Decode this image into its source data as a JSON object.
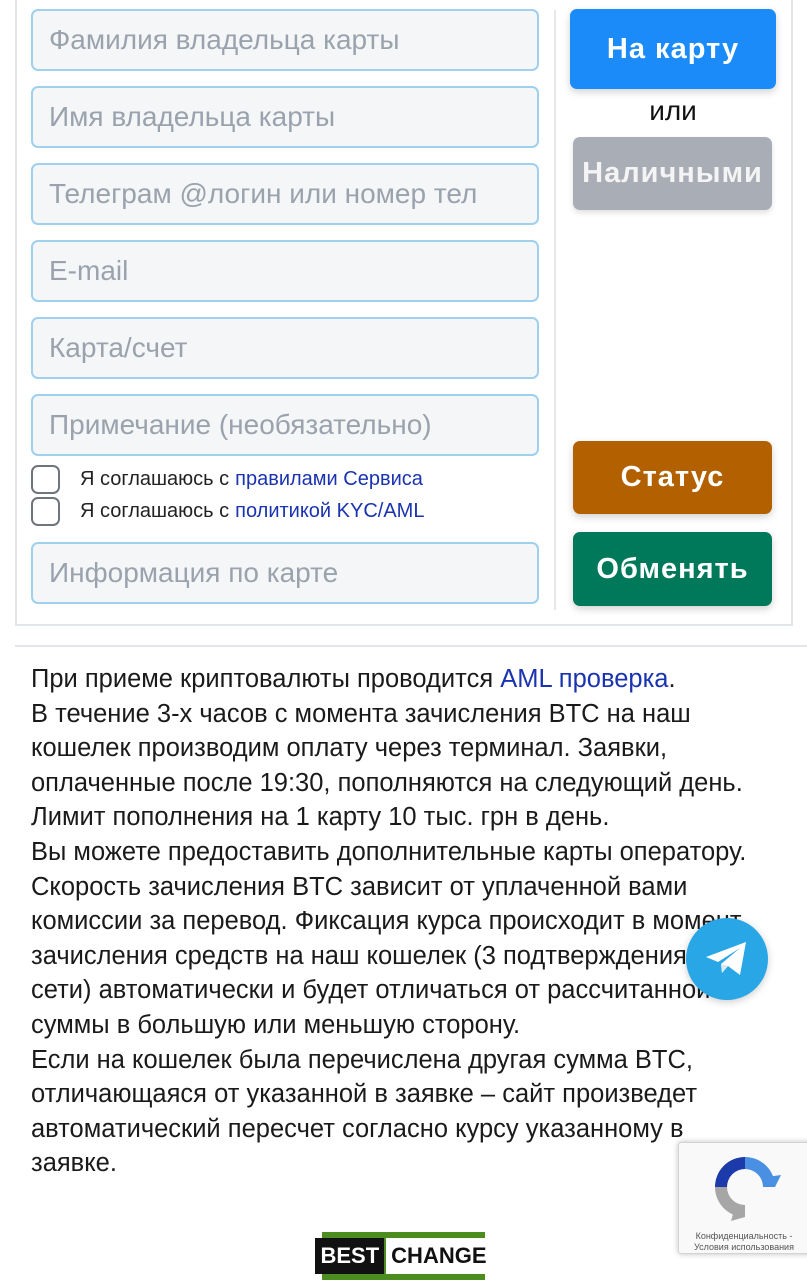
{
  "form": {
    "fields": [
      {
        "placeholder": "Фамилия владельца карты"
      },
      {
        "placeholder": "Имя владельца карты"
      },
      {
        "placeholder": "Телеграм @логин или номер тел"
      },
      {
        "placeholder": "E-mail"
      },
      {
        "placeholder": "Карта/счет"
      },
      {
        "placeholder": "Примечание (необязательно)"
      }
    ],
    "agree_rules": {
      "prefix": "Я соглашаюсь с",
      "link": "правилами Сервиса"
    },
    "agree_kyc": {
      "prefix": "Я соглашаюсь с",
      "link": "политикой KYC/AML"
    },
    "card_info_placeholder": "Информация по карте"
  },
  "actions": {
    "to_card": "На карту",
    "or": "или",
    "cash": "Наличными",
    "status": "Статус",
    "exchange": "Обменять"
  },
  "info": {
    "l1_text": "При приеме криптовалюты проводится ",
    "l1_link": "AML проверка",
    "l1_end": ".",
    "lines": [
      "В течение 3-х часов с момента зачисления BTC на наш",
      "кошелек производим оплату через терминал. Заявки,",
      "оплаченные после 19:30, пополняются на следующий день.",
      "Лимит пополнения на 1 карту 10 тыс. грн в день.",
      "Вы можете предоставить дополнительные карты оператору.",
      "Скорость зачисления BTC зависит от уплаченной вами",
      "комиссии за перевод. Фиксация курса происходит в момент",
      "зачисления средств на наш кошелек (3 подтверждения",
      "сети) автоматически и будет отличаться от рассчитанной",
      "суммы в большую или меньшую сторону.",
      "Если на кошелек была перечислена другая сумма BTC,",
      "отличающаяся от указанной в заявке – сайт произведет",
      "автоматический пересчет согласно курсу указанному в",
      "заявке."
    ]
  },
  "recaptcha": {
    "privacy": "Конфиденциальность -",
    "terms": "Условия использования"
  },
  "bestchange": {
    "best": "BEST",
    "change": "CHANGE"
  },
  "colors": {
    "to_card": "#1b8bf9",
    "cash": "#a9aeb6",
    "status": "#b26000",
    "exchange": "#00795a",
    "telegram": "#28a6e6",
    "link": "#1a33b0"
  }
}
